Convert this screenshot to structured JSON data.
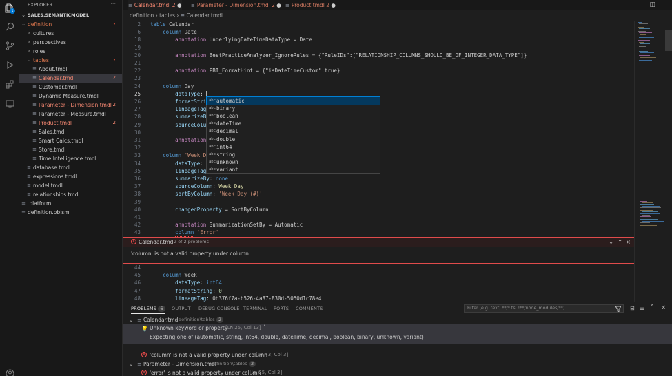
{
  "sidebar": {
    "title": "EXPLORER",
    "more": "···",
    "project": "SALES.SEMANTICMODEL",
    "items": [
      {
        "label": "definition",
        "kind": "folder",
        "open": true,
        "badge": "•"
      },
      {
        "label": "cultures",
        "kind": "folder",
        "open": false
      },
      {
        "label": "perspectives",
        "kind": "folder",
        "open": false
      },
      {
        "label": "roles",
        "kind": "folder",
        "open": false
      },
      {
        "label": "tables",
        "kind": "folder",
        "open": true,
        "badge": "•"
      },
      {
        "label": "About.tmdl",
        "kind": "file"
      },
      {
        "label": "Calendar.tmdl",
        "kind": "file",
        "error": true,
        "badge": "2",
        "selected": true
      },
      {
        "label": "Customer.tmdl",
        "kind": "file"
      },
      {
        "label": "Dynamic Measure.tmdl",
        "kind": "file"
      },
      {
        "label": "Parameter - Dimension.tmdl",
        "kind": "file",
        "error": true,
        "badge": "2"
      },
      {
        "label": "Parameter - Measure.tmdl",
        "kind": "file"
      },
      {
        "label": "Product.tmdl",
        "kind": "file",
        "error": true,
        "badge": "2"
      },
      {
        "label": "Sales.tmdl",
        "kind": "file"
      },
      {
        "label": "Smart Calcs.tmdl",
        "kind": "file"
      },
      {
        "label": "Store.tmdl",
        "kind": "file"
      },
      {
        "label": "Time Intelligence.tmdl",
        "kind": "file"
      },
      {
        "label": "database.tmdl",
        "kind": "file"
      },
      {
        "label": "expressions.tmdl",
        "kind": "file"
      },
      {
        "label": "model.tmdl",
        "kind": "file"
      },
      {
        "label": "relationships.tmdl",
        "kind": "file"
      },
      {
        "label": ".platform",
        "kind": "file"
      },
      {
        "label": "definition.pbism",
        "kind": "file"
      }
    ]
  },
  "tabs": [
    {
      "label": "Calendar.tmdl",
      "count": "2",
      "active": true
    },
    {
      "label": "Parameter - Dimension.tmdl",
      "count": "2"
    },
    {
      "label": "Product.tmdl",
      "count": "2"
    }
  ],
  "breadcrumb": [
    "definition",
    "tables",
    "Calendar.tmdl"
  ],
  "editor_top": [
    {
      "n": "2",
      "t": [
        [
          "kw",
          "table "
        ],
        [
          "pl",
          "Calendar"
        ]
      ]
    },
    {
      "n": "6",
      "t": [
        [
          "pl",
          "    "
        ],
        [
          "kw",
          "column "
        ],
        [
          "pl",
          "Date"
        ]
      ]
    },
    {
      "n": "18",
      "t": [
        [
          "pl",
          "        "
        ],
        [
          "ky",
          "annotation "
        ],
        [
          "pl",
          "UnderlyingDateTimeDataType = Date"
        ]
      ]
    },
    {
      "n": "19",
      "t": []
    },
    {
      "n": "20",
      "t": [
        [
          "pl",
          "        "
        ],
        [
          "ky",
          "annotation "
        ],
        [
          "pl",
          "BestPracticeAnalyzer_IgnoreRules = {\"RuleIDs\":[\"RELATIONSHIP_COLUMNS_SHOULD_BE_OF_INTEGER_DATA_TYPE\"]}"
        ]
      ]
    },
    {
      "n": "21",
      "t": []
    },
    {
      "n": "22",
      "t": [
        [
          "pl",
          "        "
        ],
        [
          "ky",
          "annotation "
        ],
        [
          "pl",
          "PBI_FormatHint = {\"isDateTimeCustom\":true}"
        ]
      ]
    },
    {
      "n": "23",
      "t": []
    },
    {
      "n": "24",
      "t": [
        [
          "pl",
          "    "
        ],
        [
          "kw",
          "column "
        ],
        [
          "pl",
          "Day"
        ]
      ]
    },
    {
      "n": "25",
      "t": [
        [
          "pl",
          "        "
        ],
        [
          "pr",
          "dataType"
        ],
        [
          "pl",
          ": "
        ]
      ],
      "cur": true
    },
    {
      "n": "26",
      "t": [
        [
          "pl",
          "        "
        ],
        [
          "pr",
          "formatStri"
        ]
      ]
    },
    {
      "n": "27",
      "t": [
        [
          "pl",
          "        "
        ],
        [
          "pr",
          "lineageTag"
        ]
      ]
    },
    {
      "n": "28",
      "t": [
        [
          "pl",
          "        "
        ],
        [
          "pr",
          "summarizeB"
        ]
      ]
    },
    {
      "n": "29",
      "t": [
        [
          "pl",
          "        "
        ],
        [
          "pr",
          "sourceColu"
        ]
      ]
    },
    {
      "n": "30",
      "t": []
    },
    {
      "n": "31",
      "t": [
        [
          "pl",
          "        "
        ],
        [
          "ky",
          "annotation"
        ]
      ]
    },
    {
      "n": "32",
      "t": []
    },
    {
      "n": "33",
      "t": [
        [
          "pl",
          "    "
        ],
        [
          "kw",
          "column "
        ],
        [
          "st",
          "'Week D"
        ]
      ]
    },
    {
      "n": "34",
      "t": [
        [
          "pl",
          "        "
        ],
        [
          "pr",
          "dataType"
        ],
        [
          "pl",
          ": "
        ]
      ]
    },
    {
      "n": "35",
      "t": [
        [
          "pl",
          "        "
        ],
        [
          "pr",
          "lineageTag"
        ]
      ]
    },
    {
      "n": "36",
      "t": [
        [
          "pl",
          "        "
        ],
        [
          "pr",
          "summarizeBy"
        ],
        [
          "pl",
          ": "
        ],
        [
          "kw",
          "none"
        ]
      ]
    },
    {
      "n": "37",
      "t": [
        [
          "pl",
          "        "
        ],
        [
          "pr",
          "sourceColumn"
        ],
        [
          "pl",
          ": "
        ],
        [
          "nm",
          "Week Day"
        ]
      ]
    },
    {
      "n": "38",
      "t": [
        [
          "pl",
          "        "
        ],
        [
          "pr",
          "sortByColumn"
        ],
        [
          "pl",
          ": "
        ],
        [
          "st",
          "'Week Day (#)'"
        ]
      ]
    },
    {
      "n": "39",
      "t": []
    },
    {
      "n": "40",
      "t": [
        [
          "pl",
          "        "
        ],
        [
          "pr",
          "changedProperty"
        ],
        [
          "pl",
          " = SortByColumn"
        ]
      ]
    },
    {
      "n": "41",
      "t": []
    },
    {
      "n": "42",
      "t": [
        [
          "pl",
          "        "
        ],
        [
          "ky",
          "annotation "
        ],
        [
          "pl",
          "SummarizationSetBy = Automatic"
        ]
      ]
    },
    {
      "n": "43",
      "t": [
        [
          "pl",
          "        "
        ],
        [
          "kw",
          "column "
        ],
        [
          "st",
          "'Error'"
        ]
      ]
    }
  ],
  "suggestions": [
    "automatic",
    "binary",
    "boolean",
    "dateTime",
    "decimal",
    "double",
    "int64",
    "string",
    "unknown",
    "variant"
  ],
  "suggestion_icon": "abc",
  "peek": {
    "file": "Calendar.tmdl",
    "count": "2 of 2 problems",
    "message": "'column' is not a valid property under column"
  },
  "editor_bottom": [
    {
      "n": "44",
      "t": []
    },
    {
      "n": "45",
      "t": [
        [
          "pl",
          "    "
        ],
        [
          "kw",
          "column "
        ],
        [
          "pl",
          "Week"
        ]
      ]
    },
    {
      "n": "46",
      "t": [
        [
          "pl",
          "        "
        ],
        [
          "pr",
          "dataType"
        ],
        [
          "pl",
          ": "
        ],
        [
          "kw",
          "int64"
        ]
      ]
    },
    {
      "n": "47",
      "t": [
        [
          "pl",
          "        "
        ],
        [
          "pr",
          "formatString"
        ],
        [
          "pl",
          ": "
        ],
        [
          "sf",
          "0"
        ]
      ]
    },
    {
      "n": "48",
      "t": [
        [
          "pl",
          "        "
        ],
        [
          "pr",
          "lineageTag"
        ],
        [
          "pl",
          ": 0b376f7a-b526-4a87-830d-5050d1c78e4"
        ]
      ]
    }
  ],
  "panel": {
    "tabs": [
      "PROBLEMS",
      "OUTPUT",
      "DEBUG CONSOLE",
      "TERMINAL",
      "PORTS",
      "COMMENTS"
    ],
    "problems_count": "6",
    "filter_placeholder": "Filter (e.g. text, **/*.ts, !**/node_modules/**)",
    "groups": [
      {
        "file": "Calendar.tmdl",
        "path": "definition\\tables",
        "count": "2"
      },
      {
        "file": "Parameter - Dimension.tmdl",
        "path": "definition\\tables",
        "count": "2"
      }
    ],
    "hint_title": "Unknown keyword or property ''",
    "hint_loc": "[Ln 25, Col 13]",
    "hint_detail": "Expecting one of (automatic, string, int64, double, dateTime, decimal, boolean, binary, unknown, variant)",
    "err1": "'column' is not a valid property under column",
    "err1_loc": "[Ln 43, Col 3]",
    "err2": "'error' is not a valid property under column",
    "err2_loc": "[Ln 25, Col 3]"
  },
  "colors": {
    "accent": "#007fd4",
    "error": "#f48771"
  }
}
